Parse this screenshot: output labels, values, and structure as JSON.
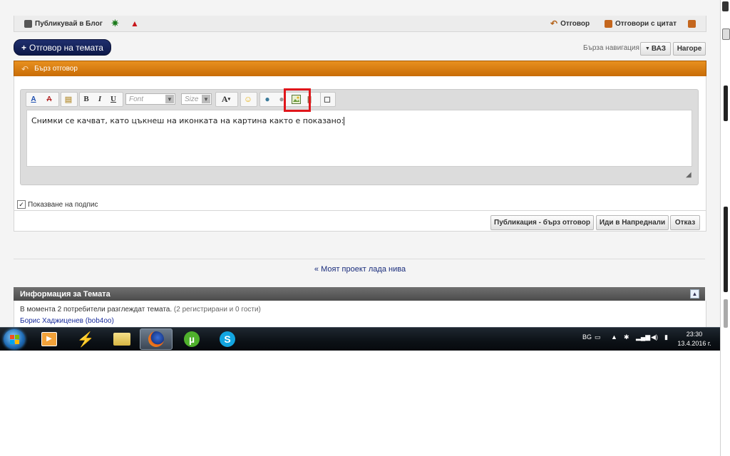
{
  "post_actions": {
    "blog_label": "Публикувай в Блог",
    "reply_label": "Отговор",
    "reply_quote_label": "Отговори с цитат"
  },
  "reply_thread_button": "Отговор на темата",
  "quick_nav": {
    "label": "Бърза навигация",
    "dropdown_value": "ВАЗ",
    "up_button": "Нагоре"
  },
  "quick_reply": {
    "header": "Бърз отговор",
    "toolbar": {
      "font_placeholder": "Font",
      "size_placeholder": "Size"
    },
    "message_text": "Снимки се качват, като цъкнеш на иконката на картина както е показано:",
    "show_signature_label": "Показване на подпис",
    "show_signature_checked": true,
    "buttons": {
      "post": "Публикация - бърз отговор",
      "advanced": "Иди в Напреднали",
      "cancel": "Отказ"
    }
  },
  "thread_nav": {
    "prefix": "«",
    "title": "Моят проект лада нива"
  },
  "thread_info": {
    "header": "Информация за Темата",
    "viewers_text": "В момента 2 потребители разглеждат темата.",
    "viewers_detail": "(2 регистрирани и 0 гости)",
    "user": "Борис Хаджиценев (bob4oo)"
  },
  "taskbar": {
    "language": "BG",
    "time": "23:30",
    "date": "13.4.2016 г."
  },
  "colors": {
    "orange_header": "#d77a10",
    "navy_button": "#14225a",
    "highlight": "#e0161b"
  }
}
